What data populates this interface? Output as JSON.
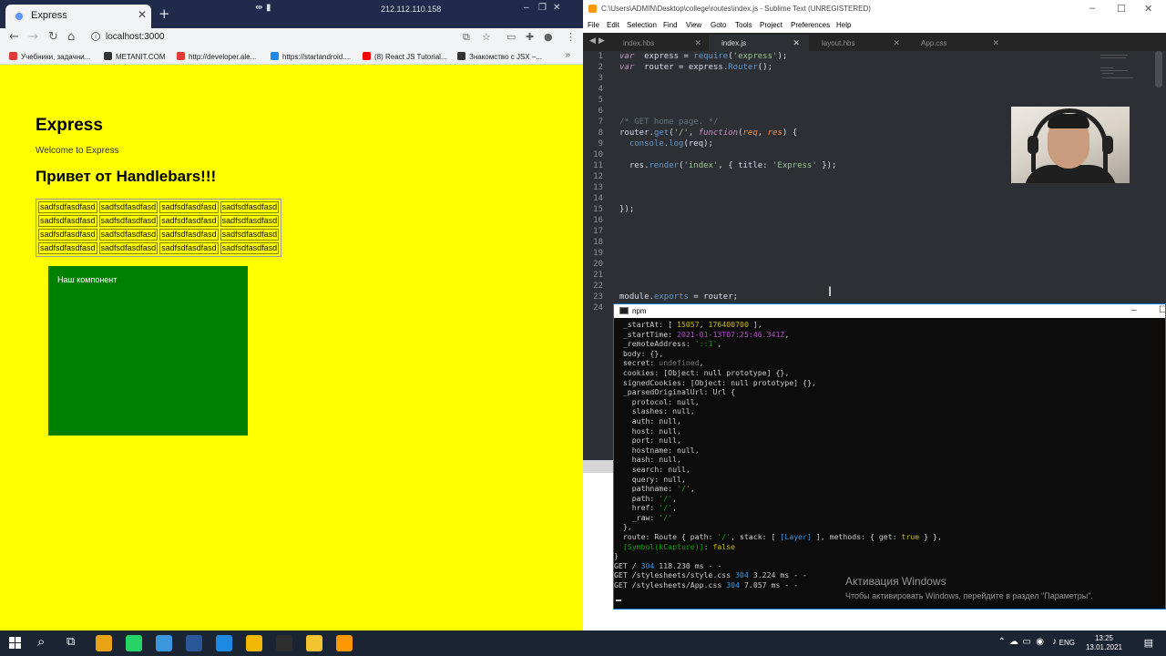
{
  "chrome": {
    "tab_title": "Express",
    "tab_close": "✕",
    "new_tab": "+",
    "caption_ip": "212.112.110.158",
    "caption_icons": [
      "⇹",
      "▮"
    ],
    "window_controls": [
      "–",
      "❐",
      "✕"
    ],
    "nav": {
      "back": "←",
      "forward": "→",
      "reload": "↻",
      "home": "⌂"
    },
    "url": "localhost:3000",
    "toolbar_icons": [
      "⧉",
      "☆",
      "▭",
      "✚",
      "●",
      "⋮"
    ],
    "bookmarks": [
      {
        "label": "Учебники, задачни...",
        "color": "#e53935"
      },
      {
        "label": "METANIT.COM",
        "color": "#333333"
      },
      {
        "label": "http://developer.ale...",
        "color": "#e53935"
      },
      {
        "label": "https://startandroid....",
        "color": "#1e88e5"
      },
      {
        "label": "(8) React JS Tutorial...",
        "color": "#ff0000"
      },
      {
        "label": "Знакомство с JSX –...",
        "color": "#333333"
      }
    ],
    "bookmarks_more": "»"
  },
  "page": {
    "heading": "Express",
    "welcome": "Welcome to Express",
    "handlebars_heading": "Привет от Handlebars!!!",
    "table_rows": [
      [
        "sadfsdfasdfasd",
        "sadfsdfasdfasd",
        "sadfsdfasdfasd",
        "sadfsdfasdfasd"
      ],
      [
        "sadfsdfasdfasd",
        "sadfsdfasdfasd",
        "sadfsdfasdfasd",
        "sadfsdfasdfasd"
      ],
      [
        "sadfsdfasdfasd",
        "sadfsdfasdfasd",
        "sadfsdfasdfasd",
        "sadfsdfasdfasd"
      ],
      [
        "sadfsdfasdfasd",
        "sadfsdfasdfasd",
        "sadfsdfasdfasd",
        "sadfsdfasdfasd"
      ]
    ],
    "component_text": "Наш компонент",
    "background": "#ffff00",
    "component_color": "#008000"
  },
  "sublime": {
    "title": "C:\\Users\\ADMIN\\Desktop\\college\\routes\\index.js - Sublime Text (UNREGISTERED)",
    "window_controls": [
      "–",
      "☐",
      "✕"
    ],
    "menu": [
      "File",
      "Edit",
      "Selection",
      "Find",
      "View",
      "Goto",
      "Tools",
      "Project",
      "Preferences",
      "Help"
    ],
    "tab_arrows": [
      "◀",
      "▶"
    ],
    "tabs": [
      {
        "label": "index.hbs",
        "active": false
      },
      {
        "label": "index.js",
        "active": true
      },
      {
        "label": "layout.hbs",
        "active": false
      },
      {
        "label": "App.css",
        "active": false
      }
    ],
    "tab_close": "✕",
    "line_numbers": [
      "1",
      "2",
      "3",
      "4",
      "5",
      "6",
      "7",
      "8",
      "9",
      "10",
      "11",
      "12",
      "13",
      "14",
      "15",
      "16",
      "17",
      "18",
      "19",
      "20",
      "21",
      "22",
      "23",
      "24"
    ],
    "code_lines": [
      [
        [
          "kw",
          "var"
        ],
        [
          "",
          "  express "
        ],
        [
          "",
          "= "
        ],
        [
          "fn",
          "require"
        ],
        [
          "",
          "("
        ],
        [
          "str",
          "'express'"
        ],
        [
          "",
          ");"
        ]
      ],
      [
        [
          "kw",
          "var"
        ],
        [
          "",
          "  router "
        ],
        [
          "",
          "= "
        ],
        [
          "",
          "express."
        ],
        [
          "fn",
          "Router"
        ],
        [
          "",
          "();"
        ]
      ],
      [],
      [],
      [],
      [],
      [
        [
          "cm",
          "/* GET home page. */"
        ]
      ],
      [
        [
          "",
          "router."
        ],
        [
          "fn",
          "get"
        ],
        [
          "",
          "("
        ],
        [
          "str",
          "'/'"
        ],
        [
          "",
          ", "
        ],
        [
          "kw",
          "function"
        ],
        [
          "",
          "("
        ],
        [
          "pm",
          "req"
        ],
        [
          "",
          ", "
        ],
        [
          "pm",
          "res"
        ],
        [
          "",
          ") {"
        ]
      ],
      [
        [
          "",
          "  "
        ],
        [
          "fn",
          "console"
        ],
        [
          "",
          "."
        ],
        [
          "fn",
          "log"
        ],
        [
          "",
          "(req);"
        ]
      ],
      [],
      [
        [
          "",
          "  res."
        ],
        [
          "fn",
          "render"
        ],
        [
          "",
          "("
        ],
        [
          "str",
          "'index'"
        ],
        [
          "",
          ", { title: "
        ],
        [
          "str",
          "'Express'"
        ],
        [
          "",
          " });"
        ]
      ],
      [],
      [],
      [],
      [
        [
          "",
          "});"
        ]
      ],
      [],
      [],
      [],
      [],
      [],
      [],
      [],
      [
        [
          "",
          "module."
        ],
        [
          "fn",
          "exports"
        ],
        [
          "",
          " = router;"
        ]
      ],
      []
    ]
  },
  "npm": {
    "title": "npm",
    "window_controls": [
      "–",
      "☐"
    ],
    "lines": [
      [
        [
          "",
          "  _startAt: [ "
        ],
        [
          "y",
          "15057"
        ],
        [
          "",
          ", "
        ],
        [
          "y",
          "176400700"
        ],
        [
          "",
          " ],"
        ]
      ],
      [
        [
          "",
          "  _startTime: "
        ],
        [
          "m",
          "2021-01-13T07:25:46.341Z"
        ],
        [
          "",
          ","
        ]
      ],
      [
        [
          "",
          "  _remoteAddress: "
        ],
        [
          "g",
          "'::1'"
        ],
        [
          "",
          ","
        ]
      ],
      [
        [
          "",
          "  body: {},"
        ]
      ],
      [
        [
          "",
          "  secret: "
        ],
        [
          "gr",
          "undefined"
        ],
        [
          "",
          ","
        ]
      ],
      [
        [
          "",
          "  cookies: [Object: null prototype] {},"
        ]
      ],
      [
        [
          "",
          "  signedCookies: [Object: null prototype] {},"
        ]
      ],
      [
        [
          "",
          "  _parsedOriginalUrl: Url {"
        ]
      ],
      [
        [
          "",
          "    protocol: null,"
        ]
      ],
      [
        [
          "",
          "    slashes: null,"
        ]
      ],
      [
        [
          "",
          "    auth: null,"
        ]
      ],
      [
        [
          "",
          "    host: null,"
        ]
      ],
      [
        [
          "",
          "    port: null,"
        ]
      ],
      [
        [
          "",
          "    hostname: null,"
        ]
      ],
      [
        [
          "",
          "    hash: null,"
        ]
      ],
      [
        [
          "",
          "    search: null,"
        ]
      ],
      [
        [
          "",
          "    query: null,"
        ]
      ],
      [
        [
          "",
          "    pathname: "
        ],
        [
          "g",
          "'/'"
        ],
        [
          "",
          ","
        ]
      ],
      [
        [
          "",
          "    path: "
        ],
        [
          "g",
          "'/'"
        ],
        [
          "",
          ","
        ]
      ],
      [
        [
          "",
          "    href: "
        ],
        [
          "g",
          "'/'"
        ],
        [
          "",
          ","
        ]
      ],
      [
        [
          "",
          "    _raw: "
        ],
        [
          "g",
          "'/'"
        ]
      ],
      [
        [
          "",
          "  },"
        ]
      ],
      [
        [
          "",
          "  route: Route { path: "
        ],
        [
          "g",
          "'/'"
        ],
        [
          "",
          ", stack: [ "
        ],
        [
          "c",
          "[Layer]"
        ],
        [
          "",
          " ], methods: { get: "
        ],
        [
          "y",
          "true"
        ],
        [
          "",
          " } },"
        ]
      ],
      [
        [
          "",
          "  "
        ],
        [
          "g",
          "[Symbol(kCapture)]"
        ],
        [
          "",
          ": "
        ],
        [
          "y",
          "false"
        ]
      ],
      [
        [
          "",
          "}"
        ]
      ],
      [
        [
          "",
          "GET / "
        ],
        [
          "c",
          "304"
        ],
        [
          "",
          " 118.230 ms - -"
        ]
      ],
      [
        [
          "",
          "GET /stylesheets/style.css "
        ],
        [
          "c",
          "304"
        ],
        [
          "",
          " 3.224 ms - -"
        ]
      ],
      [
        [
          "",
          "GET /stylesheets/App.css "
        ],
        [
          "c",
          "304"
        ],
        [
          "",
          " 7.057 ms - -"
        ]
      ]
    ]
  },
  "watermark": {
    "line1": "Активация Windows",
    "line2": "Чтобы активировать Windows, перейдите в раздел \"Параметры\"."
  },
  "taskbar": {
    "search_icon": "⌕",
    "taskview_icon": "⧉",
    "lang": "ENG",
    "time": "13:25",
    "date": "13.01.2021",
    "tray_symbols": [
      "⌃",
      "☁",
      "▭",
      "◉",
      "♪"
    ],
    "notification_icon": "▤",
    "apps": [
      {
        "name": "paint-app",
        "color": "#e8a317"
      },
      {
        "name": "whatsapp-app",
        "color": "#25d366"
      },
      {
        "name": "edge-app",
        "color": "#3a96dd"
      },
      {
        "name": "word-app",
        "color": "#2b579a"
      },
      {
        "name": "photos-app",
        "color": "#1e88e5"
      },
      {
        "name": "chrome-app",
        "color": "#f2b705"
      },
      {
        "name": "terminal-app",
        "color": "#2d2d2d"
      },
      {
        "name": "explorer-app",
        "color": "#f4c430"
      },
      {
        "name": "sublime-app",
        "color": "#ff9800"
      }
    ]
  }
}
